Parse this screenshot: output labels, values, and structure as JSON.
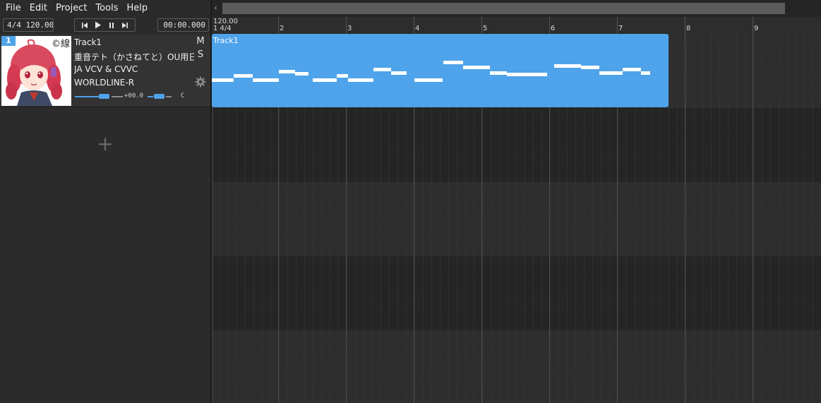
{
  "menu": [
    "File",
    "Edit",
    "Project",
    "Tools",
    "Help"
  ],
  "toolbar": {
    "tempo_display": "4/4  120.00",
    "time_display": "00:00.000"
  },
  "track": {
    "number": "1",
    "name": "Track1",
    "singer": "重音テト（かさねてと）OU用日本語統合ライブラリー",
    "phonemizer": "JA VCV & CVVC",
    "renderer": "WORLDLINE-R",
    "mute_label": "M",
    "solo_label": "S",
    "volume_text": "+00.0",
    "pan_text": "C",
    "avatar_mark": "©線"
  },
  "add_track_label": "+",
  "ruler": {
    "tempo": "120.00",
    "time_signature": "1 4/4",
    "bars": [
      "2",
      "3",
      "4",
      "5",
      "6",
      "7",
      "8",
      "9"
    ]
  },
  "part": {
    "title": "Track1"
  },
  "colors": {
    "accent": "#4ea3ea",
    "background": "#252525",
    "panel": "#2b2b2b",
    "note": "#ffffff"
  },
  "icons": {
    "prev": "skip-back-icon",
    "play": "play-icon",
    "pause": "pause-icon",
    "next": "skip-forward-icon",
    "settings": "gear-icon",
    "scroll_left": "chevron-left-icon",
    "add": "plus-icon"
  }
}
